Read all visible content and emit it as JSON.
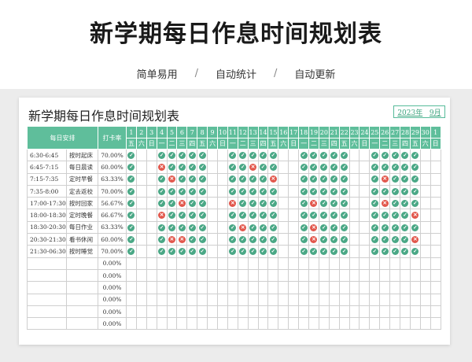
{
  "header": {
    "title": "新学期每日作息时间规划表",
    "features": [
      "简单易用",
      "自动统计",
      "自动更新"
    ],
    "separator": "/"
  },
  "sheet": {
    "title": "新学期每日作息时间规划表",
    "year": "2023年",
    "month": "9月",
    "col_schedule": "每日安排",
    "col_rate": "打卡率",
    "days": [
      "1",
      "2",
      "3",
      "4",
      "5",
      "6",
      "7",
      "8",
      "9",
      "10",
      "11",
      "12",
      "13",
      "14",
      "15",
      "16",
      "17",
      "18",
      "19",
      "20",
      "21",
      "22",
      "23",
      "24",
      "25",
      "26",
      "27",
      "28",
      "29",
      "30",
      "1"
    ],
    "weekdays": [
      "五",
      "六",
      "日",
      "一",
      "二",
      "三",
      "四",
      "五",
      "六",
      "日",
      "一",
      "二",
      "三",
      "四",
      "五",
      "六",
      "日",
      "一",
      "二",
      "三",
      "四",
      "五",
      "六",
      "日",
      "一",
      "二",
      "三",
      "四",
      "五",
      "六",
      "日"
    ],
    "rows": [
      {
        "time": "6:30-6:45",
        "activity": "按时起床",
        "rate": "70.00%",
        "marks": "o___oooooo__ooooo___ooooo___ooooo_"
      },
      {
        "time": "6:45-7:15",
        "activity": "每日晨读",
        "rate": "60.00%",
        "marks": "o___xoooo___ooxoo___ooooo___ooooo_"
      },
      {
        "time": "7:15-7:35",
        "activity": "定时早餐",
        "rate": "63.33%",
        "marks": "o___oxooo___oooox___ooooo___oxooo_"
      },
      {
        "time": "7:35-8:00",
        "activity": "定去返校",
        "rate": "70.00%",
        "marks": "o___ooooo___ooooo___ooooo___ooooo_"
      },
      {
        "time": "17:00-17:30",
        "activity": "按时回家",
        "rate": "56.67%",
        "marks": "o___ooxoo___xoooo___oxooo___oxooo_"
      },
      {
        "time": "18:00-18:30",
        "activity": "定时晚餐",
        "rate": "66.67%",
        "marks": "o___xoooo___ooooo___ooooo___oooox_"
      },
      {
        "time": "18:30-20:30",
        "activity": "每日作业",
        "rate": "63.33%",
        "marks": "o___ooooo___oxooo___oxooo___ooooo_"
      },
      {
        "time": "20:30-21:30",
        "activity": "看书休闲",
        "rate": "60.00%",
        "marks": "o___oxxoo___ooooo___oxooo___oooox_"
      },
      {
        "time": "21:30-06:30",
        "activity": "按时睡觉",
        "rate": "70.00%",
        "marks": "o___ooooo___ooooo___ooooo___ooooo_"
      },
      {
        "time": "",
        "activity": "",
        "rate": "0.00%",
        "marks": ""
      },
      {
        "time": "",
        "activity": "",
        "rate": "0.00%",
        "marks": ""
      },
      {
        "time": "",
        "activity": "",
        "rate": "0.00%",
        "marks": ""
      },
      {
        "time": "",
        "activity": "",
        "rate": "0.00%",
        "marks": ""
      },
      {
        "time": "",
        "activity": "",
        "rate": "0.00%",
        "marks": ""
      },
      {
        "time": "",
        "activity": "",
        "rate": "0.00%",
        "marks": ""
      }
    ]
  },
  "icons": {
    "checked": "check-circle-icon",
    "missed": "cross-circle-icon"
  },
  "colors": {
    "accent": "#5fbe9b",
    "check": "#4aa886",
    "cross": "#e2574c"
  }
}
